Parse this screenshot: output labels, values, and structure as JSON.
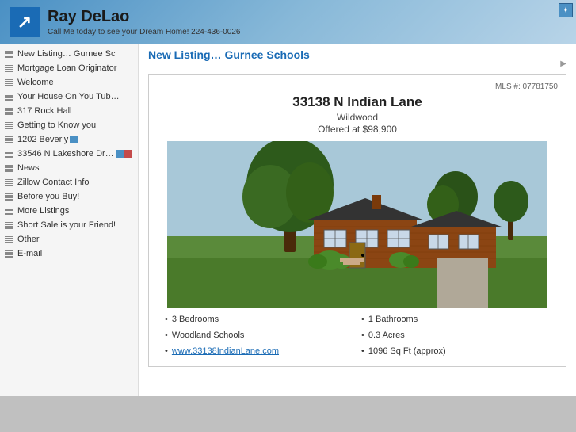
{
  "header": {
    "name": "Ray DeLao",
    "tagline": "Call Me today to see your Dream Home! 224-436-0026",
    "logo_symbol": "↗"
  },
  "page_title": "New Listing… Gurnee Schools",
  "listing": {
    "mls": "MLS #: 07781750",
    "address": "33138 N Indian Lane",
    "city": "Wildwood",
    "price": "Offered at $98,900",
    "features_col1": [
      "3 Bedrooms",
      "Woodland Schools",
      "www.33138IndianLane.com"
    ],
    "features_col2": [
      "1 Bathrooms",
      "0.3 Acres",
      "1096 Sq Ft (approx)"
    ]
  },
  "sidebar": {
    "items": [
      {
        "label": "New Listing… Gurnee Sc",
        "badge": null
      },
      {
        "label": "Mortgage Loan Originator",
        "badge": null
      },
      {
        "label": "Welcome",
        "badge": null
      },
      {
        "label": "Your House On You Tub…",
        "badge": null
      },
      {
        "label": "317 Rock Hall",
        "badge": null
      },
      {
        "label": "Getting to Know you",
        "badge": null
      },
      {
        "label": "1202 Beverly",
        "badge": "blue"
      },
      {
        "label": "33546 N Lakeshore Dr…",
        "badge": "both"
      },
      {
        "label": "News",
        "badge": null
      },
      {
        "label": "Zillow Contact Info",
        "badge": null
      },
      {
        "label": "Before you Buy!",
        "badge": null
      },
      {
        "label": "More Listings",
        "badge": null
      },
      {
        "label": "Short Sale is your Friend!",
        "badge": null
      },
      {
        "label": "Other",
        "badge": null
      },
      {
        "label": "E-mail",
        "badge": null
      }
    ]
  },
  "colors": {
    "accent_blue": "#1a6bb5",
    "header_bg_start": "#4a90c4",
    "title_color": "#1a6bb5"
  }
}
